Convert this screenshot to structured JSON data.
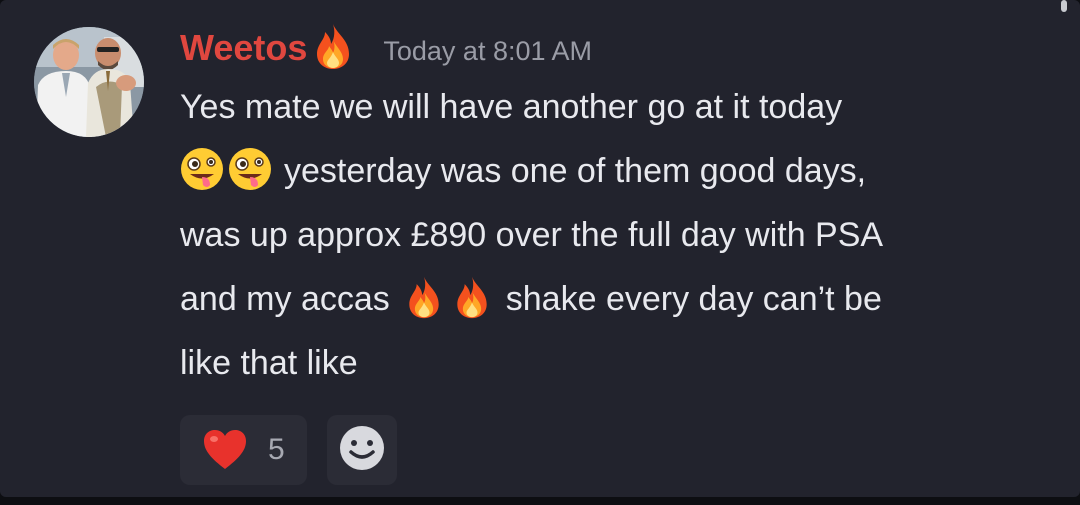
{
  "message": {
    "author": {
      "name": "Weetos",
      "name_icon": "fire-emoji",
      "avatar": "avatar-two-men-photo"
    },
    "timestamp": "Today at 8:01 AM",
    "lines": {
      "l1": "Yes mate we will have another go at it today",
      "l2_text": "yesterday was one of them good days,",
      "l3": "was up approx £890 over the full day with PSA",
      "l4_pre": "and my accas",
      "l4_post": "shake every day can’t be",
      "l5": "like that like"
    },
    "inline_emojis": [
      "zany-face-emoji",
      "zany-face-emoji",
      "fire-emoji",
      "fire-emoji"
    ]
  },
  "reactions": [
    {
      "emoji": "red-heart-emoji",
      "count": "5"
    }
  ],
  "add_reaction_icon": "smiley-add-reaction-icon",
  "colors": {
    "background": "#22232d",
    "username": "#e0473f",
    "text": "#e8e9ee",
    "timestamp": "#9a9ca6",
    "reaction_bg": "#2b2c36"
  }
}
